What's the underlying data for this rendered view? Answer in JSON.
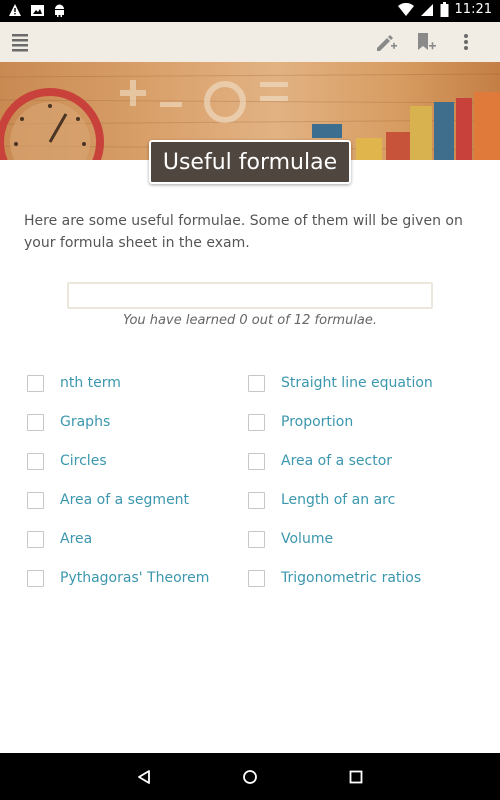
{
  "status_bar": {
    "time": "11:21",
    "icons": [
      "warning-icon",
      "photo-icon",
      "android-icon",
      "wifi-icon",
      "signal-icon",
      "battery-icon"
    ]
  },
  "toolbar": {
    "icons": [
      "menu-icon",
      "edit-note-icon",
      "bookmark-add-icon",
      "more-vert-icon"
    ]
  },
  "page": {
    "title": "Useful formulae",
    "intro": "Here are some useful formulae. Some of them will be given on your formula sheet in the exam.",
    "progress": {
      "learned": 0,
      "total": 12,
      "fraction": 0,
      "text": "You have learned 0 out of 12 formulae."
    }
  },
  "formulae": {
    "left": [
      {
        "label": "nth term",
        "checked": false
      },
      {
        "label": "Graphs",
        "checked": false
      },
      {
        "label": "Circles",
        "checked": false
      },
      {
        "label": "Area of a segment",
        "checked": false
      },
      {
        "label": "Area",
        "checked": false
      },
      {
        "label": "Pythagoras' Theorem",
        "checked": false
      }
    ],
    "right": [
      {
        "label": "Straight line equation",
        "checked": false
      },
      {
        "label": "Proportion",
        "checked": false
      },
      {
        "label": "Area of a sector",
        "checked": false
      },
      {
        "label": "Length of an arc",
        "checked": false
      },
      {
        "label": "Volume",
        "checked": false
      },
      {
        "label": "Trigonometric ratios",
        "checked": false
      }
    ]
  },
  "nav_bar": {
    "icons": [
      "back-icon",
      "home-icon",
      "recents-icon"
    ]
  },
  "colors": {
    "accent": "#3b97ad",
    "title_bg": "#4f463f",
    "toolbar_bg": "#f1ede5"
  }
}
